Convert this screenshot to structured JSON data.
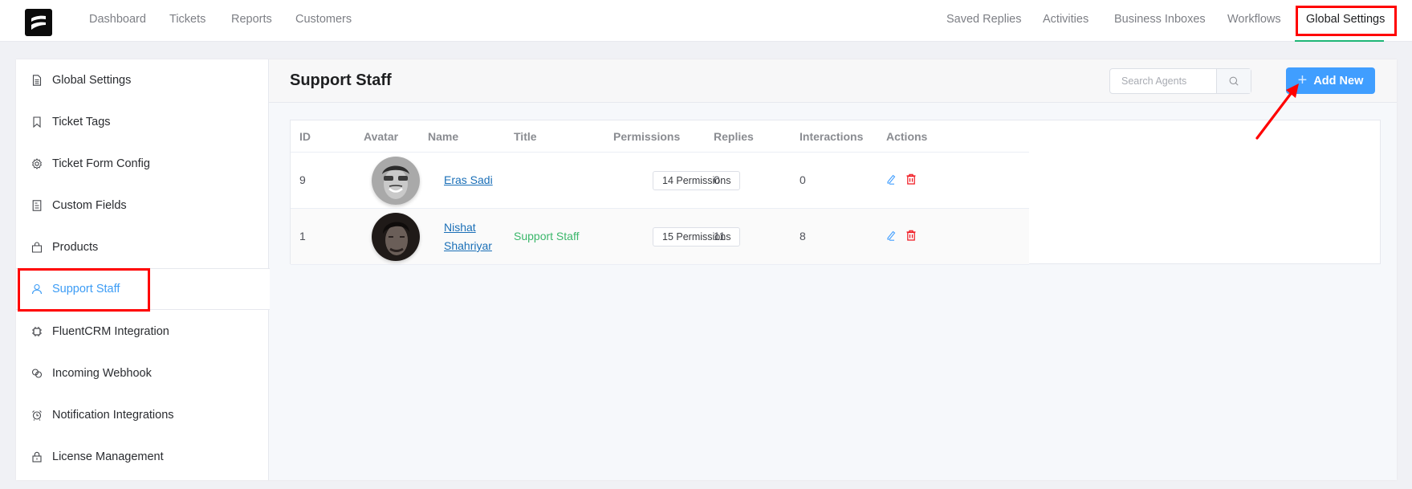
{
  "topnav": {
    "left_links": [
      "Dashboard",
      "Tickets",
      "Reports",
      "Customers"
    ],
    "right_links": [
      "Saved Replies",
      "Activities",
      "Business Inboxes",
      "Workflows",
      "Global Settings"
    ],
    "active": "Global Settings",
    "active_color": "#1fb677"
  },
  "sidebar": {
    "items": [
      {
        "label": "Global Settings",
        "icon": "document-icon"
      },
      {
        "label": "Ticket Tags",
        "icon": "bookmark-icon"
      },
      {
        "label": "Ticket Form Config",
        "icon": "gear-icon"
      },
      {
        "label": "Custom Fields",
        "icon": "list-document-icon"
      },
      {
        "label": "Products",
        "icon": "shopping-bag-icon"
      },
      {
        "label": "Support Staff",
        "icon": "user-icon"
      },
      {
        "label": "FluentCRM Integration",
        "icon": "chip-icon"
      },
      {
        "label": "Incoming Webhook",
        "icon": "link-icon"
      },
      {
        "label": "Notification Integrations",
        "icon": "alarm-clock-icon"
      },
      {
        "label": "License Management",
        "icon": "lock-icon"
      }
    ],
    "active": "Support Staff",
    "active_color": "#3c9cf5"
  },
  "main": {
    "title": "Support Staff",
    "search": {
      "placeholder": "Search Agents",
      "value": ""
    },
    "add_button": "Add New",
    "accent": "#409eff"
  },
  "table": {
    "columns": [
      "ID",
      "Avatar",
      "Name",
      "Title",
      "Permissions",
      "Replies",
      "Interactions",
      "Actions"
    ],
    "rows": [
      {
        "id": "9",
        "name": "Eras Sadi",
        "title": "",
        "permissions": "14 Permissions",
        "replies": "0",
        "interactions": "0"
      },
      {
        "id": "1",
        "name": "Nishat Shahriyar",
        "title": "Support Staff",
        "permissions": "15 Permissions",
        "replies": "11",
        "interactions": "8"
      }
    ]
  }
}
